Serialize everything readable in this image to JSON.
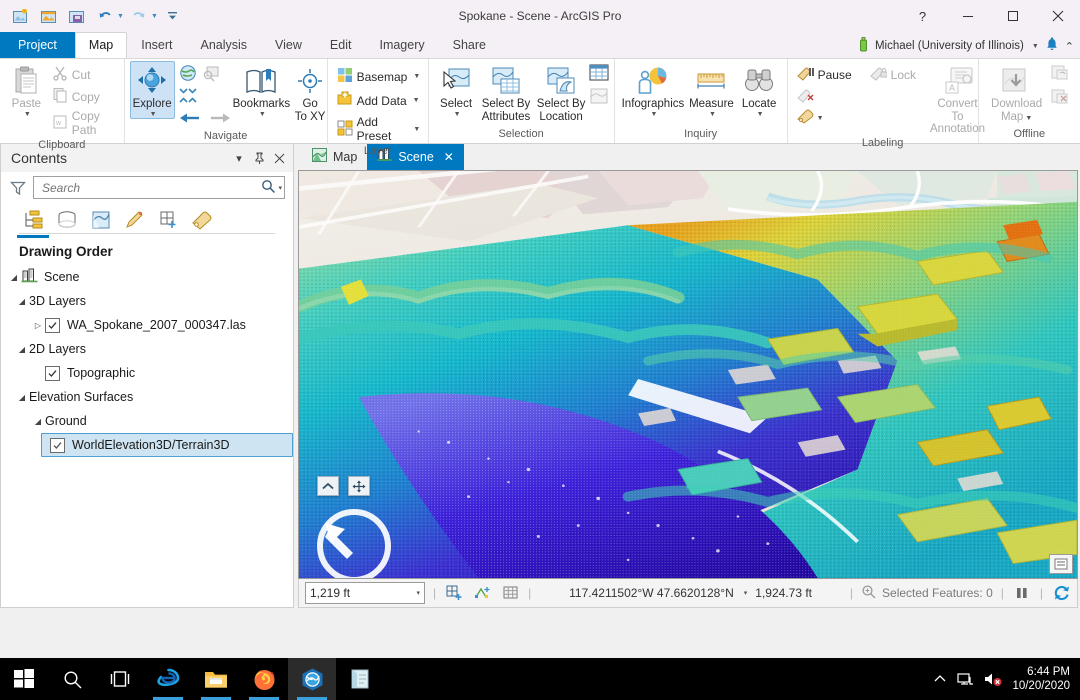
{
  "window": {
    "title": "Spokane - Scene - ArcGIS Pro",
    "help": "?",
    "minimize": "—",
    "restore": "❐",
    "close": "✕"
  },
  "quick_access": [
    {
      "name": "new-project-icon",
      "tooltip": "New"
    },
    {
      "name": "open-project-icon",
      "tooltip": "Open"
    },
    {
      "name": "save-project-icon",
      "tooltip": "Save"
    },
    {
      "name": "undo-icon",
      "tooltip": "Undo"
    },
    {
      "name": "redo-icon",
      "tooltip": "Redo"
    },
    {
      "name": "customize-quick-access-icon",
      "tooltip": "Customize"
    }
  ],
  "ribbon": {
    "tabs": [
      {
        "label": "Project",
        "state": "backstage"
      },
      {
        "label": "Map",
        "state": "active"
      },
      {
        "label": "Insert",
        "state": "normal"
      },
      {
        "label": "Analysis",
        "state": "normal"
      },
      {
        "label": "View",
        "state": "normal"
      },
      {
        "label": "Edit",
        "state": "normal"
      },
      {
        "label": "Imagery",
        "state": "normal"
      },
      {
        "label": "Share",
        "state": "normal"
      }
    ],
    "user": "Michael (University of Illinois)",
    "groups": {
      "clipboard": {
        "label": "Clipboard",
        "paste": "Paste",
        "cut": "Cut",
        "copy": "Copy",
        "copy_path": "Copy Path"
      },
      "navigate": {
        "label": "Navigate",
        "explore": "Explore",
        "bookmarks": "Bookmarks",
        "go_to_xy_line1": "Go",
        "go_to_xy_line2": "To XY"
      },
      "layer": {
        "label": "Layer",
        "basemap": "Basemap",
        "add_data": "Add Data",
        "add_preset": "Add Preset"
      },
      "selection": {
        "label": "Selection",
        "select": "Select",
        "select_by_attributes_line1": "Select By",
        "select_by_attributes_line2": "Attributes",
        "select_by_location_line1": "Select By",
        "select_by_location_line2": "Location"
      },
      "inquiry": {
        "label": "Inquiry",
        "infographics": "Infographics",
        "measure": "Measure",
        "locate": "Locate"
      },
      "labeling": {
        "label": "Labeling",
        "pause": "Pause",
        "lock": "Lock",
        "convert_line1": "Convert To",
        "convert_line2": "Annotation"
      },
      "offline": {
        "label": "Offline",
        "download_map_line1": "Download",
        "download_map_line2": "Map"
      }
    }
  },
  "contents": {
    "title": "Contents",
    "search_placeholder": "Search",
    "search_value": "",
    "tab_icons": [
      {
        "name": "drawing-order-icon",
        "active": true
      },
      {
        "name": "data-source-icon",
        "active": false
      },
      {
        "name": "selection-icon",
        "active": false
      },
      {
        "name": "editing-icon",
        "active": false
      },
      {
        "name": "snapping-icon",
        "active": false
      },
      {
        "name": "labeling-tab-icon",
        "active": false
      }
    ],
    "heading": "Drawing Order",
    "tree": [
      {
        "label": "Scene",
        "level": 0,
        "expander": "down",
        "checkbox": null,
        "icon": "scene-icon"
      },
      {
        "label": "3D Layers",
        "level": 1,
        "expander": "down",
        "checkbox": null
      },
      {
        "label": "WA_Spokane_2007_000347.las",
        "level": 2,
        "expander": "right",
        "checkbox": true
      },
      {
        "label": "2D Layers",
        "level": 1,
        "expander": "down",
        "checkbox": null
      },
      {
        "label": "Topographic",
        "level": 2,
        "expander": null,
        "checkbox": true
      },
      {
        "label": "Elevation Surfaces",
        "level": 1,
        "expander": "down",
        "checkbox": null
      },
      {
        "label": "Ground",
        "level": 2,
        "expander": "down",
        "checkbox": null
      },
      {
        "label": "WorldElevation3D/Terrain3D",
        "level": 3,
        "expander": null,
        "checkbox": true,
        "selected": true
      }
    ]
  },
  "view_tabs": [
    {
      "label": "Map",
      "active": false,
      "closable": false,
      "icon": "map-view-icon"
    },
    {
      "label": "Scene",
      "active": true,
      "closable": true,
      "icon": "scene-view-icon"
    }
  ],
  "statusbar": {
    "scale": "1,219 ft",
    "coordinates": "117.4211502°W 47.6620128°N",
    "elevation": "1,924.73 ft",
    "selected_features": "Selected Features: 0",
    "icons": [
      "add-map-frame-icon",
      "snap-to-icon",
      "grid-icon",
      "locate-selection-icon",
      "pause-drawing-icon",
      "refresh-icon"
    ]
  },
  "scene": {
    "navigator": {
      "up_button": "chevron-up-icon",
      "pan_button": "pan-move-icon",
      "compass": "compass-north-arrow"
    },
    "overlay_button": "legend-overlay-icon",
    "colors": {
      "point_cloud_low": "#3b1bc8",
      "point_cloud_mid": "#17b6c4",
      "point_cloud_high": "#d4cf2b",
      "point_cloud_top": "#e07a18",
      "basemap_land": "#f2efe9",
      "basemap_water": "#b8dcea",
      "accent": "#0079c1"
    }
  },
  "taskbar": {
    "items": [
      {
        "name": "start-button-icon",
        "state": "normal"
      },
      {
        "name": "search-icon",
        "state": "normal"
      },
      {
        "name": "task-view-icon",
        "state": "normal"
      },
      {
        "name": "internet-explorer-icon",
        "state": "open"
      },
      {
        "name": "file-explorer-icon",
        "state": "open"
      },
      {
        "name": "firefox-icon",
        "state": "open"
      },
      {
        "name": "arcgis-pro-icon",
        "state": "active"
      },
      {
        "name": "notepad-icon",
        "state": "normal"
      }
    ],
    "tray": {
      "show_hidden": "show-hidden-icons-chevron",
      "network": "network-icon",
      "volume": "volume-muted-icon",
      "time": "6:44 PM",
      "date": "10/20/2020"
    }
  }
}
